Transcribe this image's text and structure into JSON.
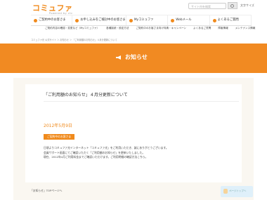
{
  "header": {
    "logo_text": "コミュファ",
    "logo_sub": "Powered by ctc",
    "search_placeholder": "サイト内を検索",
    "font_size_label": "文字サイズ"
  },
  "nav_main": [
    {
      "label": "ご契約中のお客さま"
    },
    {
      "label": "お申し込みをご検討中のお客さま"
    },
    {
      "label": "Myコミュファ"
    },
    {
      "label": "Webメール"
    },
    {
      "label": "よくあるご質問"
    }
  ],
  "nav_sub": [
    {
      "label": "ご契約内容の確認・変更など（Myコミュファ）"
    },
    {
      "label": "各種接続・設定方法"
    },
    {
      "label": "ご契約中のお客さま向け特典・キャンペーン"
    },
    {
      "label": "よくあるご質問"
    },
    {
      "label": "障害情報"
    },
    {
      "label": "メンテナンス情報"
    }
  ],
  "breadcrumb": "コミュファ光 公式サイト ＞ お知らせ ＞ 「ご利用額のお知らせ」４月分更新について",
  "banner": {
    "title": "お知らせ"
  },
  "article": {
    "title": "「ご利用額のお知らせ」４月分更新について",
    "date": "2012年5月9日",
    "tag": "ご契約中のお客さま",
    "paragraphs": [
      "日頃よりコミュファ光インターネット「コミュファ光」をご利用いただき、誠にありがとうございます。",
      "会員サポート画面にてご確認いただく「ご利用額のお知らせ」を更新いたしました。",
      "現在、2012年4月ご利用料金までご確認いただけます。ご利用明細の確認方法こちら。"
    ]
  },
  "back_link": "「お知らせ」TOPページへ",
  "page_top": "ページトップへ"
}
